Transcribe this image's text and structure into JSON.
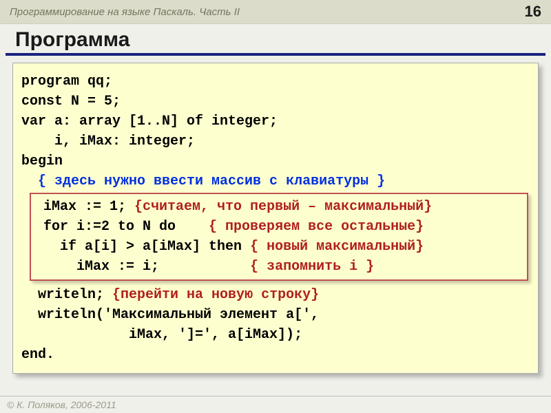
{
  "header": {
    "title": "Программирование на языке Паскаль. Часть II",
    "page_number": "16"
  },
  "section_title": "Программа",
  "code": {
    "l01": "program qq;",
    "l02": "const N = 5;",
    "l03": "var a: array [1..N] of integer;",
    "l04": "    i, iMax: integer;",
    "l05": "begin",
    "l06_cmt": "  { здесь нужно ввести массив с клавиатуры }",
    "hl": {
      "l07a": " iMax := 1; ",
      "l07b": "{считаем, что первый – максимальный}",
      "l08a": " for i:=2 to N do    ",
      "l08b": "{ проверяем все остальные}",
      "l09a": "   if a[i] > a[iMax] then ",
      "l09b": "{ новый максимальный}",
      "l10a": "     iMax := i;           ",
      "l10b": "{ запомнить i }"
    },
    "l11a": "  writeln; ",
    "l11b": "{перейти на новую строку}",
    "l12": "  writeln('Максимальный элемент a[',",
    "l13": "             iMax, ']=', a[iMax]);",
    "l14": "end."
  },
  "footer": "© К. Поляков, 2006-2011"
}
